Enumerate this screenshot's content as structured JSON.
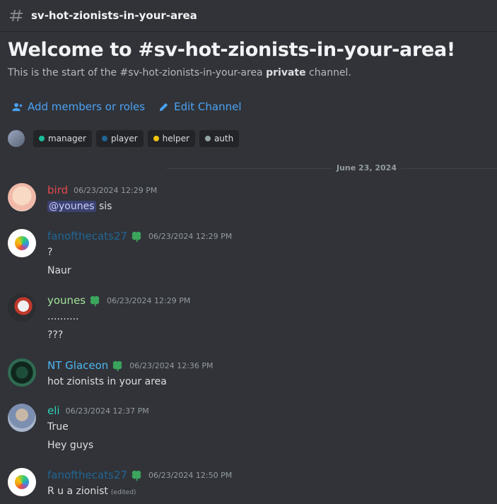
{
  "channel": {
    "name": "sv-hot-zionists-in-your-area",
    "welcome_title": "Welcome to #sv-hot-zionists-in-your-area!",
    "welcome_prefix": "This is the start of the #sv-hot-zionists-in-your-area ",
    "welcome_bold": "private",
    "welcome_suffix": " channel."
  },
  "actions": {
    "add_members": "Add members or roles",
    "edit_channel": "Edit Channel"
  },
  "roles": [
    {
      "label": "manager",
      "color": "#1abc9c"
    },
    {
      "label": "player",
      "color": "#206694"
    },
    {
      "label": "helper",
      "color": "#f1c40f"
    },
    {
      "label": "auth",
      "color": "#95a5a6"
    }
  ],
  "date_divider": "June 23, 2024",
  "messages": [
    {
      "author": "bird",
      "author_color": "#e5484d",
      "timestamp": "06/23/2024 12:29 PM",
      "mention": "@younes",
      "lines": [
        " sis"
      ]
    },
    {
      "author": "fanofthecats27",
      "author_color": "#206694",
      "timestamp": "06/23/2024 12:29 PM",
      "lines": [
        "?",
        "Naur"
      ]
    },
    {
      "author": "younes",
      "author_color": "#a3e29a",
      "timestamp": "06/23/2024 12:29 PM",
      "lines": [
        "..........",
        "???"
      ]
    },
    {
      "author": "NT Glaceon",
      "author_color": "#4bb8f0",
      "timestamp": "06/23/2024 12:36 PM",
      "lines": [
        "hot zionists in your area"
      ]
    },
    {
      "author": "eli",
      "author_color": "#2ed1b5",
      "timestamp": "06/23/2024 12:37 PM",
      "lines": [
        "True",
        "Hey guys"
      ]
    },
    {
      "author": "fanofthecats27",
      "author_color": "#206694",
      "timestamp": "06/23/2024 12:50 PM",
      "lines": [
        "R u a zionist"
      ],
      "edited": "(edited)"
    }
  ]
}
